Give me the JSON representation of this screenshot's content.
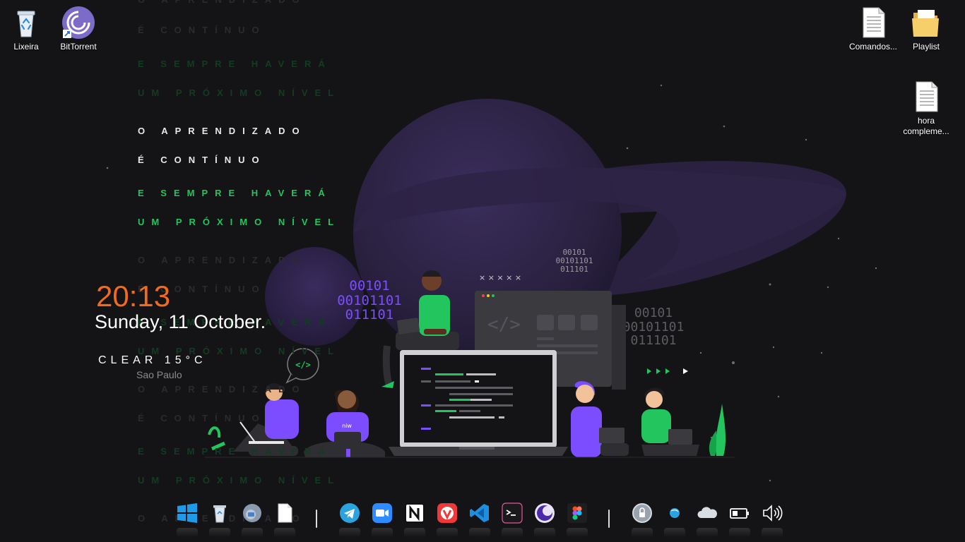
{
  "desktop": {
    "icons_left": [
      {
        "label": "Lixeira",
        "icon": "recycle-bin-icon"
      },
      {
        "label": "BitTorrent",
        "icon": "bittorrent-icon"
      }
    ],
    "icons_right": [
      {
        "label": "Comandos...",
        "icon": "text-file-icon"
      },
      {
        "label": "Playlist",
        "icon": "folder-icon"
      },
      {
        "label": "hora compleme...",
        "icon": "text-file-icon"
      }
    ]
  },
  "wallpaper": {
    "motto": {
      "line1": "O APRENDIZADO",
      "line2": "É CONTÍNUO",
      "line3": "E SEMPRE HAVERÁ",
      "line4": "UM PRÓXIMO NÍVEL"
    },
    "binary": {
      "left": [
        "00101",
        "00101101",
        "011101"
      ],
      "top_right": [
        "00101",
        "00101101",
        "011101"
      ],
      "right": [
        "00101",
        "00101101",
        "011101"
      ]
    },
    "code_tag": "</>",
    "shirt_text": "niw",
    "marks": "× × × × ×",
    "colors": {
      "accent_green": "#22c55e",
      "accent_purple": "#7c4dff",
      "planet": "#2a2140"
    }
  },
  "widget": {
    "time": "20:13",
    "date": "Sunday, 11 October.",
    "weather": "CLEAR 15°C",
    "city": "Sao Paulo",
    "time_color": "#f26b1d"
  },
  "dock": {
    "apps": [
      {
        "name": "windows-start-icon"
      },
      {
        "name": "recycle-bin-icon"
      },
      {
        "name": "drive-icon"
      },
      {
        "name": "document-icon"
      },
      {
        "name": "telegram-icon"
      },
      {
        "name": "zoom-icon"
      },
      {
        "name": "notion-icon"
      },
      {
        "name": "vivaldi-icon"
      },
      {
        "name": "vscode-icon"
      },
      {
        "name": "terminal-icon"
      },
      {
        "name": "moon-app-icon"
      },
      {
        "name": "figma-icon"
      }
    ],
    "tray": [
      {
        "name": "lock-icon"
      },
      {
        "name": "network-globe-icon"
      },
      {
        "name": "onedrive-cloud-icon"
      },
      {
        "name": "battery-icon"
      },
      {
        "name": "volume-icon"
      }
    ]
  }
}
